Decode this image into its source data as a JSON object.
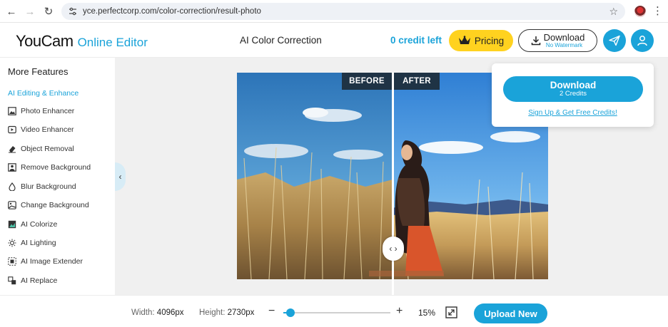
{
  "browser": {
    "url": "yce.perfectcorp.com/color-correction/result-photo",
    "icons": [
      "back-icon",
      "forward-icon",
      "reload-icon",
      "site-settings-icon",
      "bookmark-star-icon",
      "profile-icon",
      "menu-kebab-icon"
    ]
  },
  "header": {
    "logo_main": "YouCam",
    "logo_sub": "Online Editor",
    "title": "AI Color Correction",
    "credits": "0 credit left",
    "pricing_label": "Pricing",
    "download_label": "Download",
    "download_sub": "No Watermark"
  },
  "sidebar": {
    "title": "More Features",
    "section": "AI Editing & Enhance",
    "items": [
      {
        "label": "Photo Enhancer",
        "icon": "photo-enhancer-icon"
      },
      {
        "label": "Video Enhancer",
        "icon": "video-enhancer-icon"
      },
      {
        "label": "Object Removal",
        "icon": "eraser-icon"
      },
      {
        "label": "Remove Background",
        "icon": "remove-background-icon"
      },
      {
        "label": "Blur Background",
        "icon": "blur-drop-icon"
      },
      {
        "label": "Change Background",
        "icon": "change-background-icon"
      },
      {
        "label": "AI Colorize",
        "icon": "colorize-icon"
      },
      {
        "label": "AI Lighting",
        "icon": "lighting-sun-icon"
      },
      {
        "label": "AI Image Extender",
        "icon": "image-extender-icon"
      },
      {
        "label": "AI Replace",
        "icon": "replace-icon"
      }
    ]
  },
  "preview": {
    "before_label": "BEFORE",
    "after_label": "AFTER"
  },
  "download_popup": {
    "button_label": "Download",
    "button_sub": "2 Credits",
    "signup_link": "Sign Up & Get Free Credits!"
  },
  "footer": {
    "width_label": "Width:",
    "width_value": "4096px",
    "height_label": "Height:",
    "height_value": "2730px",
    "zoom_fraction": 0.05,
    "zoom_percent": "15%",
    "upload_label": "Upload New"
  },
  "colors": {
    "accent": "#1aa3d9",
    "pricing": "#ffd21f",
    "tag_bg": "#1f3345"
  }
}
